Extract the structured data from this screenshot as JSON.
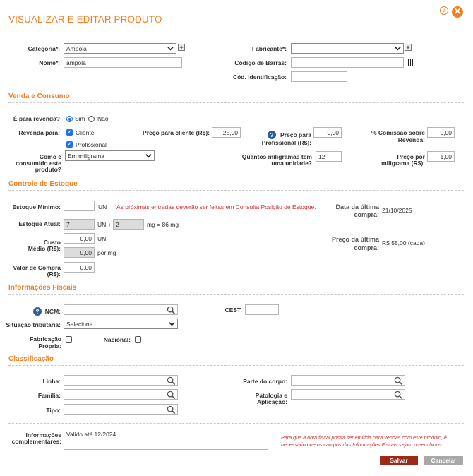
{
  "header": {
    "title": "VISUALIZAR E EDITAR PRODUTO",
    "help_glyph": "?",
    "close_glyph": "✕"
  },
  "top": {
    "categoria_label": "Categoria*:",
    "categoria_value": "Ampola",
    "nome_label": "Nome*:",
    "nome_value": "ampola",
    "fabricante_label": "Fabricante*:",
    "fabricante_value": "",
    "codbarras_label": "Código de Barras:",
    "codbarras_value": "",
    "codident_label": "Cód. Identificação:",
    "codident_value": "",
    "plus_glyph": "+"
  },
  "venda": {
    "section_title": "Venda e Consumo",
    "revenda_label": "É para revenda?",
    "sim_label": "Sim",
    "nao_label": "Não",
    "revenda_para_label": "Revenda para:",
    "cliente_label": "Cliente",
    "profissional_label": "Profissional",
    "preco_cliente_label": "Preço para cliente (R$):",
    "preco_cliente_value": "25,00",
    "preco_prof_label_1": "Preço para",
    "preco_prof_label_2": "Profissional (R$):",
    "preco_prof_value": "0,00",
    "comissao_label_1": "% Comissão sobre",
    "comissao_label_2": "Revenda:",
    "comissao_value": "0,00",
    "consumo_label_1": "Como é",
    "consumo_label_2": "consumido este",
    "consumo_label_3": "produto?",
    "consumo_value": "Em miligrama",
    "qtd_mg_label_1": "Quantos miligramas tem",
    "qtd_mg_label_2": "uma unidade?",
    "qtd_mg_value": "12",
    "preco_mg_label_1": "Preço por",
    "preco_mg_label_2": "miligrama (R$):",
    "preco_mg_value": "1,00",
    "check_glyph": "✓",
    "help_glyph": "?"
  },
  "estoque": {
    "section_title": "Controle de Estoque",
    "min_label": "Estoque Mínimo:",
    "min_value": "",
    "min_unit": "UN",
    "warn_text": "As próximas entradas deverão ser feitas em",
    "warn_link": "Consulta Posição de Estoque.",
    "atual_label": "Estoque Atual:",
    "atual_un_value": "7",
    "atual_un_text": "UN +",
    "atual_mg_value": "2",
    "atual_mg_text": "mg = 86 mg",
    "custo_label_1": "Custo",
    "custo_label_2": "Médio (R$):",
    "custo_un_value": "0,00",
    "custo_un_text": "UN",
    "custo_mg_value": "0,00",
    "custo_mg_text": "por mg",
    "compra_label_1": "Valor de Compra",
    "compra_label_2": "(R$):",
    "compra_value": "0,00",
    "data_ult_label_1": "Data da última",
    "data_ult_label_2": "compra:",
    "data_ult_value": "21/10/2025",
    "preco_ult_label_1": "Preço da última",
    "preco_ult_label_2": "compra:",
    "preco_ult_value": "R$ 55,00 (cada)"
  },
  "fiscais": {
    "section_title": "Informações Fiscais",
    "ncm_label": "NCM:",
    "ncm_value": "",
    "cest_label": "CEST:",
    "cest_value": "",
    "situacao_label": "Situação tributária:",
    "situacao_value": "Selecione...",
    "fabricacao_label_1": "Fabricação",
    "fabricacao_label_2": "Própria:",
    "nacional_label": "Nacional:",
    "help_glyph": "?"
  },
  "classificacao": {
    "section_title": "Classificação",
    "linha_label": "Linha:",
    "familia_label": "Família:",
    "tipo_label": "Tipo:",
    "parte_label": "Parte do corpo:",
    "patologia_label_1": "Patologia e",
    "patologia_label_2": "Aplicação:"
  },
  "complementares": {
    "label_1": "Informações",
    "label_2": "complementares:",
    "value": "Valido até 12/2024",
    "note": "Para que a nota fiscal possa ser emitida para vendas com este produto, é necessário que os campos das Informações Fiscais sejam preenchidos."
  },
  "footer": {
    "save_label": "Salvar",
    "cancel_label": "Cancelar"
  },
  "colors": {
    "accent": "#f47f20",
    "save": "#9c2a16",
    "cancel": "#a8a8a8",
    "check": "#1a73e8",
    "warning": "#d32f2f"
  },
  "icons": {
    "caret": "chevron-down-icon",
    "search": "search-icon",
    "barcode": "barcode-icon",
    "plus": "plus-icon"
  }
}
